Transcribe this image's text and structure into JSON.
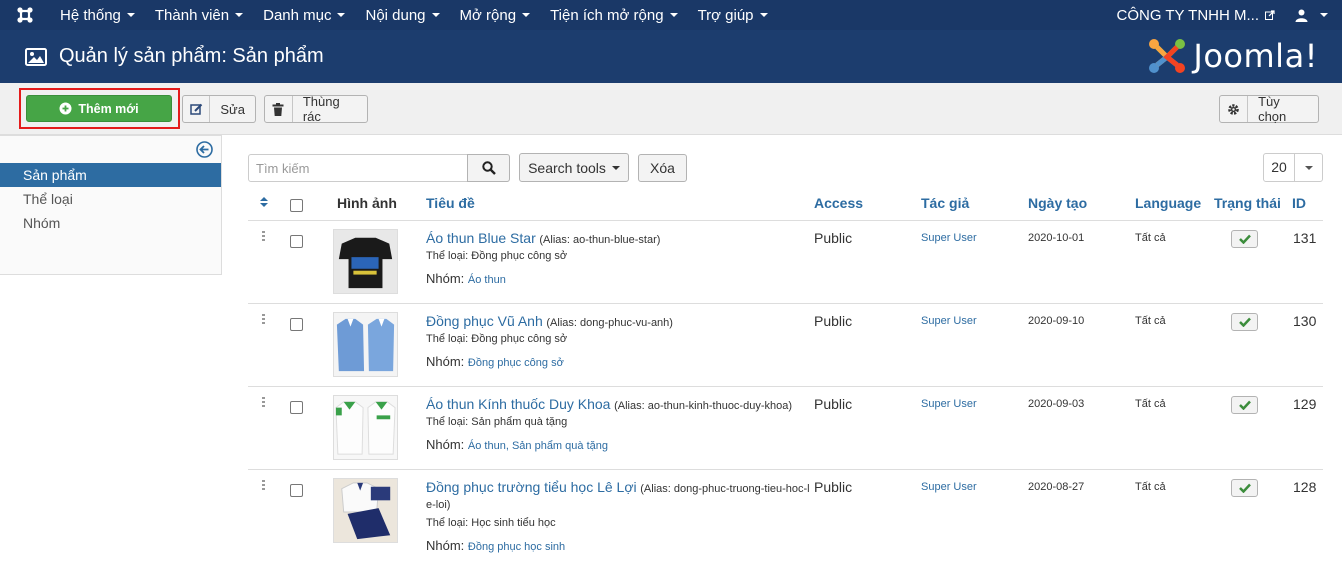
{
  "topnav": {
    "menus": [
      "Hệ thống",
      "Thành viên",
      "Danh mục",
      "Nội dung",
      "Mở rộng",
      "Tiện ích mở rộng",
      "Trợ giúp"
    ],
    "company": "CÔNG TY TNHH M...",
    "icons": [
      "joomla-icon",
      "external-link-icon",
      "user-icon"
    ]
  },
  "header": {
    "title": "Quản lý sản phẩm: Sản phẩm",
    "brand": "Joomla!"
  },
  "toolbar": {
    "new_label": "Thêm mới",
    "edit_label": "Sửa",
    "trash_label": "Thùng rác",
    "options_label": "Tùy chọn"
  },
  "sidebar": {
    "items": [
      {
        "label": "Sản phẩm",
        "active": true
      },
      {
        "label": "Thể loại",
        "active": false
      },
      {
        "label": "Nhóm",
        "active": false
      }
    ]
  },
  "filters": {
    "search_placeholder": "Tìm kiếm",
    "search_tools_label": "Search tools",
    "clear_label": "Xóa",
    "limit": "20"
  },
  "table": {
    "columns": {
      "image": "Hình ảnh",
      "title": "Tiêu đề",
      "access": "Access",
      "author": "Tác giả",
      "created": "Ngày tạo",
      "language": "Language",
      "status": "Trạng thái",
      "id": "ID"
    },
    "rows": [
      {
        "title": "Áo thun Blue Star",
        "alias": "(Alias: ao-thun-blue-star)",
        "category_label": "Thể loại:",
        "category": "Đồng phục công sở",
        "group_label": "Nhóm:",
        "group": "Áo thun",
        "access": "Public",
        "author": "Super User",
        "created": "2020-10-01",
        "language": "Tất cả",
        "id": "131"
      },
      {
        "title": "Đồng phục Vũ Anh",
        "alias": "(Alias: dong-phuc-vu-anh)",
        "category_label": "Thể loại:",
        "category": "Đồng phục công sở",
        "group_label": "Nhóm:",
        "group": "Đồng phục công sở",
        "access": "Public",
        "author": "Super User",
        "created": "2020-09-10",
        "language": "Tất cả",
        "id": "130"
      },
      {
        "title": "Áo thun Kính thuốc Duy Khoa",
        "alias": "(Alias: ao-thun-kinh-thuoc-duy-khoa)",
        "category_label": "Thể loại:",
        "category": "Sản phẩm quà tặng",
        "group_label": "Nhóm:",
        "group": "Áo thun, Sản phẩm quà tặng",
        "access": "Public",
        "author": "Super User",
        "created": "2020-09-03",
        "language": "Tất cả",
        "id": "129"
      },
      {
        "title": "Đồng phục trường tiểu học Lê Lợi",
        "alias_line1": "(Alias: dong-phuc-truong-tieu-hoc-l",
        "alias_line2": "e-loi)",
        "category_label": "Thể loại:",
        "category": "Học sinh tiểu học",
        "group_label": "Nhóm:",
        "group": "Đồng phục học sinh",
        "access": "Public",
        "author": "Super User",
        "created": "2020-08-27",
        "language": "Tất cả",
        "id": "128"
      }
    ]
  },
  "colors": {
    "nav_bg": "#1a3867",
    "header_bg": "#1c3d6e",
    "new_button": "#46a546",
    "highlight_box": "#e41b1b",
    "link": "#2d6ca2",
    "sidebar_active": "#2d6ca2"
  }
}
